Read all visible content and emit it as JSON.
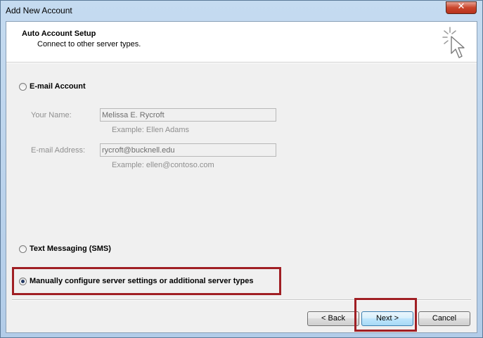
{
  "window": {
    "title": "Add New Account",
    "close_glyph": "✕"
  },
  "header": {
    "title": "Auto Account Setup",
    "subtitle": "Connect to other server types.",
    "icon": "cursor-sparkle-icon"
  },
  "options": {
    "email_account": {
      "label": "E-mail Account",
      "selected": false
    },
    "sms": {
      "label": "Text Messaging (SMS)",
      "selected": false
    },
    "manual": {
      "label": "Manually configure server settings or additional server types",
      "selected": true
    }
  },
  "fields": {
    "name": {
      "label": "Your Name:",
      "value": "Melissa E. Rycroft",
      "example": "Example: Ellen Adams"
    },
    "email": {
      "label": "E-mail Address:",
      "value": "rycroft@bucknell.edu",
      "example": "Example: ellen@contoso.com"
    }
  },
  "buttons": {
    "back": "< Back",
    "next": "Next >",
    "cancel": "Cancel"
  },
  "colors": {
    "highlight": "#a01f24",
    "title_bar": "#c5dbf0",
    "dialog_bg": "#f0f0f0"
  }
}
